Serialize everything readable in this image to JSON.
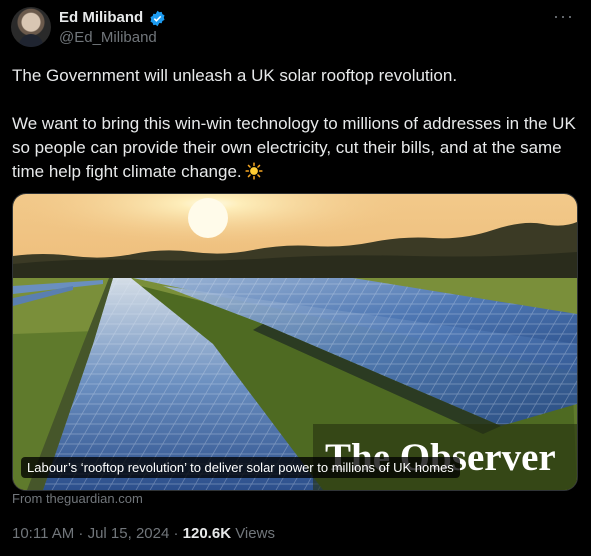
{
  "author": {
    "name": "Ed Miliband",
    "handle": "@Ed_Miliband"
  },
  "menu_label": "···",
  "tweet": {
    "paragraph1": "The Government will unleash a UK solar rooftop revolution.",
    "paragraph2": "We want to bring this win-win technology to millions of addresses in the UK so people can provide their own electricity, cut their bills, and at the same time help fight climate change."
  },
  "card": {
    "brand": "The Observer",
    "caption": "Labour’s ‘rooftop revolution’ to deliver solar power to millions of UK homes",
    "source": "From theguardian.com"
  },
  "meta": {
    "time": "10:11 AM · Jul 15, 2024 · ",
    "views_count": "120.6K",
    "views_label": " Views"
  },
  "colors": {
    "background": "#000000",
    "text": "#e7e9ea",
    "muted": "#71767b",
    "verified": "#1d9bf0"
  },
  "icons": [
    "verified-badge-icon",
    "more-icon",
    "sun-emoji-icon"
  ]
}
